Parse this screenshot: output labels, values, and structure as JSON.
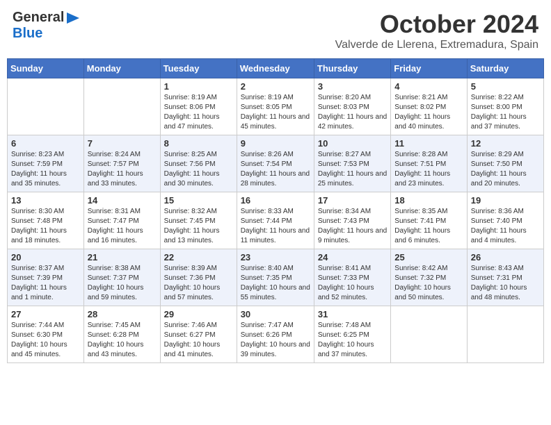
{
  "header": {
    "logo_general": "General",
    "logo_blue": "Blue",
    "month_title": "October 2024",
    "subtitle": "Valverde de Llerena, Extremadura, Spain"
  },
  "weekdays": [
    "Sunday",
    "Monday",
    "Tuesday",
    "Wednesday",
    "Thursday",
    "Friday",
    "Saturday"
  ],
  "weeks": [
    [
      {
        "day": "",
        "info": ""
      },
      {
        "day": "",
        "info": ""
      },
      {
        "day": "1",
        "info": "Sunrise: 8:19 AM\nSunset: 8:06 PM\nDaylight: 11 hours and 47 minutes."
      },
      {
        "day": "2",
        "info": "Sunrise: 8:19 AM\nSunset: 8:05 PM\nDaylight: 11 hours and 45 minutes."
      },
      {
        "day": "3",
        "info": "Sunrise: 8:20 AM\nSunset: 8:03 PM\nDaylight: 11 hours and 42 minutes."
      },
      {
        "day": "4",
        "info": "Sunrise: 8:21 AM\nSunset: 8:02 PM\nDaylight: 11 hours and 40 minutes."
      },
      {
        "day": "5",
        "info": "Sunrise: 8:22 AM\nSunset: 8:00 PM\nDaylight: 11 hours and 37 minutes."
      }
    ],
    [
      {
        "day": "6",
        "info": "Sunrise: 8:23 AM\nSunset: 7:59 PM\nDaylight: 11 hours and 35 minutes."
      },
      {
        "day": "7",
        "info": "Sunrise: 8:24 AM\nSunset: 7:57 PM\nDaylight: 11 hours and 33 minutes."
      },
      {
        "day": "8",
        "info": "Sunrise: 8:25 AM\nSunset: 7:56 PM\nDaylight: 11 hours and 30 minutes."
      },
      {
        "day": "9",
        "info": "Sunrise: 8:26 AM\nSunset: 7:54 PM\nDaylight: 11 hours and 28 minutes."
      },
      {
        "day": "10",
        "info": "Sunrise: 8:27 AM\nSunset: 7:53 PM\nDaylight: 11 hours and 25 minutes."
      },
      {
        "day": "11",
        "info": "Sunrise: 8:28 AM\nSunset: 7:51 PM\nDaylight: 11 hours and 23 minutes."
      },
      {
        "day": "12",
        "info": "Sunrise: 8:29 AM\nSunset: 7:50 PM\nDaylight: 11 hours and 20 minutes."
      }
    ],
    [
      {
        "day": "13",
        "info": "Sunrise: 8:30 AM\nSunset: 7:48 PM\nDaylight: 11 hours and 18 minutes."
      },
      {
        "day": "14",
        "info": "Sunrise: 8:31 AM\nSunset: 7:47 PM\nDaylight: 11 hours and 16 minutes."
      },
      {
        "day": "15",
        "info": "Sunrise: 8:32 AM\nSunset: 7:45 PM\nDaylight: 11 hours and 13 minutes."
      },
      {
        "day": "16",
        "info": "Sunrise: 8:33 AM\nSunset: 7:44 PM\nDaylight: 11 hours and 11 minutes."
      },
      {
        "day": "17",
        "info": "Sunrise: 8:34 AM\nSunset: 7:43 PM\nDaylight: 11 hours and 9 minutes."
      },
      {
        "day": "18",
        "info": "Sunrise: 8:35 AM\nSunset: 7:41 PM\nDaylight: 11 hours and 6 minutes."
      },
      {
        "day": "19",
        "info": "Sunrise: 8:36 AM\nSunset: 7:40 PM\nDaylight: 11 hours and 4 minutes."
      }
    ],
    [
      {
        "day": "20",
        "info": "Sunrise: 8:37 AM\nSunset: 7:39 PM\nDaylight: 11 hours and 1 minute."
      },
      {
        "day": "21",
        "info": "Sunrise: 8:38 AM\nSunset: 7:37 PM\nDaylight: 10 hours and 59 minutes."
      },
      {
        "day": "22",
        "info": "Sunrise: 8:39 AM\nSunset: 7:36 PM\nDaylight: 10 hours and 57 minutes."
      },
      {
        "day": "23",
        "info": "Sunrise: 8:40 AM\nSunset: 7:35 PM\nDaylight: 10 hours and 55 minutes."
      },
      {
        "day": "24",
        "info": "Sunrise: 8:41 AM\nSunset: 7:33 PM\nDaylight: 10 hours and 52 minutes."
      },
      {
        "day": "25",
        "info": "Sunrise: 8:42 AM\nSunset: 7:32 PM\nDaylight: 10 hours and 50 minutes."
      },
      {
        "day": "26",
        "info": "Sunrise: 8:43 AM\nSunset: 7:31 PM\nDaylight: 10 hours and 48 minutes."
      }
    ],
    [
      {
        "day": "27",
        "info": "Sunrise: 7:44 AM\nSunset: 6:30 PM\nDaylight: 10 hours and 45 minutes."
      },
      {
        "day": "28",
        "info": "Sunrise: 7:45 AM\nSunset: 6:28 PM\nDaylight: 10 hours and 43 minutes."
      },
      {
        "day": "29",
        "info": "Sunrise: 7:46 AM\nSunset: 6:27 PM\nDaylight: 10 hours and 41 minutes."
      },
      {
        "day": "30",
        "info": "Sunrise: 7:47 AM\nSunset: 6:26 PM\nDaylight: 10 hours and 39 minutes."
      },
      {
        "day": "31",
        "info": "Sunrise: 7:48 AM\nSunset: 6:25 PM\nDaylight: 10 hours and 37 minutes."
      },
      {
        "day": "",
        "info": ""
      },
      {
        "day": "",
        "info": ""
      }
    ]
  ]
}
